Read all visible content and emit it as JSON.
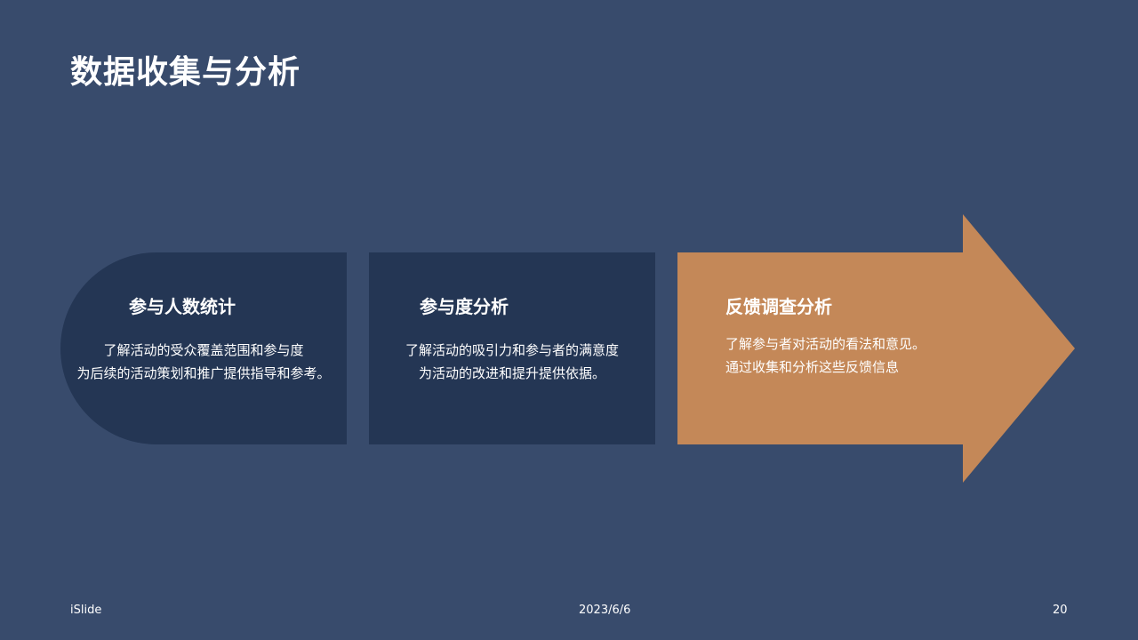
{
  "slide": {
    "title": "数据收集与分析",
    "colors": {
      "background": "#384b6c",
      "card_dark": "#243654",
      "arrow_accent": "#c48858",
      "text": "#ffffff"
    },
    "cards": [
      {
        "heading": "参与人数统计",
        "lines": [
          "了解活动的受众覆盖范围和参与度",
          "为后续的活动策划和推广提供指导和参考。"
        ]
      },
      {
        "heading": "参与度分析",
        "lines": [
          "了解活动的吸引力和参与者的满意度",
          "为活动的改进和提升提供依据。"
        ]
      },
      {
        "heading": "反馈调查分析",
        "lines": [
          "了解参与者对活动的看法和意见。",
          "通过收集和分析这些反馈信息"
        ]
      }
    ]
  },
  "footer": {
    "brand": "iSlide",
    "date": "2023/6/6",
    "page_number": "20"
  }
}
